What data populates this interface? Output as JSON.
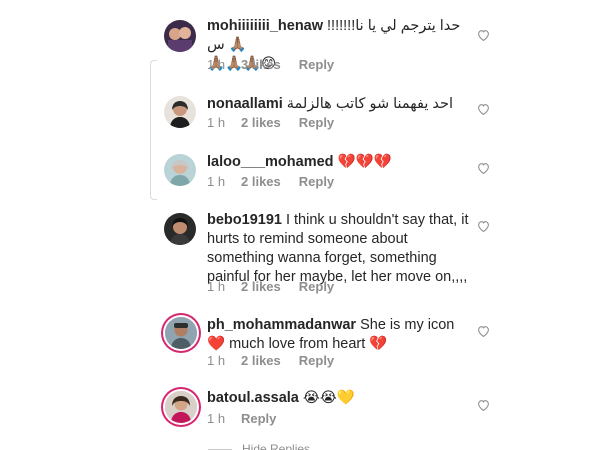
{
  "comments": [
    {
      "username": "mohiiiiiiii_henaw",
      "text": "حدا يترجم لي يا نا!!!!!!!س 🙏🏽",
      "text_line2": "🙏🏽🙏🏽🙏🏽😊",
      "time": "1 h",
      "likes": "3 likes",
      "reply": "Reply"
    },
    {
      "username": "nonaallami",
      "text": "احد يفهمنا شو كاتب هالزلمة",
      "time": "1 h",
      "likes": "2 likes",
      "reply": "Reply"
    },
    {
      "username": "laloo___mohamed",
      "text": "💔💔💔",
      "time": "1 h",
      "likes": "2 likes",
      "reply": "Reply"
    },
    {
      "username": "bebo19191",
      "text": "I think u shouldn't say that, it hurts to remind someone about something wanna forget, something painful for her maybe, let her move on,,,,",
      "time": "1 h",
      "likes": "2 likes",
      "reply": "Reply"
    },
    {
      "username": "ph_mohammadanwar",
      "text": "She is my icon ❤️ much love from heart 💔",
      "time": "1 h",
      "likes": "2 likes",
      "reply": "Reply"
    },
    {
      "username": "batoul.assala",
      "text": "😭😭💛",
      "time": "1 h",
      "likes": "",
      "reply": "Reply"
    }
  ],
  "hide_replies": "Hide Replies",
  "colors": {
    "meta": "#8e8e8e",
    "text": "#262626",
    "story_ring": "#d6266f"
  }
}
